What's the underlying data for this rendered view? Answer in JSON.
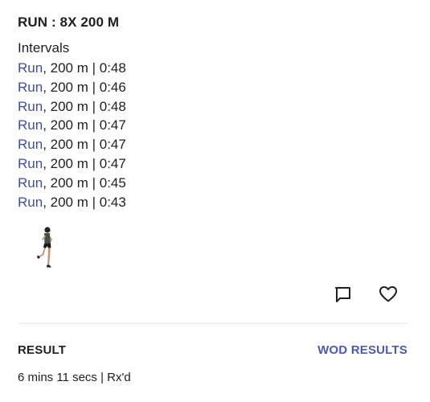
{
  "workout": {
    "title": "RUN : 8X 200 M",
    "section_label": "Intervals",
    "intervals": [
      {
        "movement": "Run",
        "details": ", 200 m | 0:48"
      },
      {
        "movement": "Run",
        "details": ", 200 m | 0:46"
      },
      {
        "movement": "Run",
        "details": ", 200 m | 0:48"
      },
      {
        "movement": "Run",
        "details": ", 200 m | 0:47"
      },
      {
        "movement": "Run",
        "details": ", 200 m | 0:47"
      },
      {
        "movement": "Run",
        "details": ", 200 m | 0:47"
      },
      {
        "movement": "Run",
        "details": ", 200 m | 0:45"
      },
      {
        "movement": "Run",
        "details": ", 200 m | 0:43"
      }
    ],
    "media": {
      "icon": "runner-figure"
    },
    "actions": {
      "comment_icon": "comment-icon",
      "like_icon": "heart-icon"
    }
  },
  "result": {
    "label": "RESULT",
    "link_label": "WOD RESULTS",
    "value": "6 mins 11 secs | Rx'd"
  },
  "colors": {
    "text": "#1f1f24",
    "accent": "#4b5aad",
    "movement_link": "#3c4fa0",
    "divider": "#e6e6ea"
  }
}
